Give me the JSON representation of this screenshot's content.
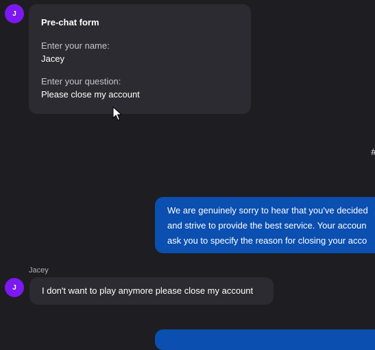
{
  "prechat": {
    "avatar_initial": "J",
    "title": "Pre-chat form",
    "name_label": "Enter your name:",
    "name_value": "Jacey",
    "question_label": "Enter your question:",
    "question_value": "Please close my account"
  },
  "stray_glyph": "#",
  "agent_message_1": {
    "lines": [
      "We are genuinely sorry to hear that you've decided",
      "and strive to provide the best service. Your accoun",
      "ask you to specify the reason for closing your acco"
    ]
  },
  "user_message_2": {
    "sender": "Jacey",
    "avatar_initial": "J",
    "text": "I don't want to play anymore please close my account"
  },
  "colors": {
    "background": "#1e1d21",
    "incoming_bubble": "#2c2b31",
    "outgoing_bubble": "#0b4fb0",
    "avatar": "#7b19f0"
  },
  "icons": {
    "cursor": "mouse-pointer-icon"
  }
}
